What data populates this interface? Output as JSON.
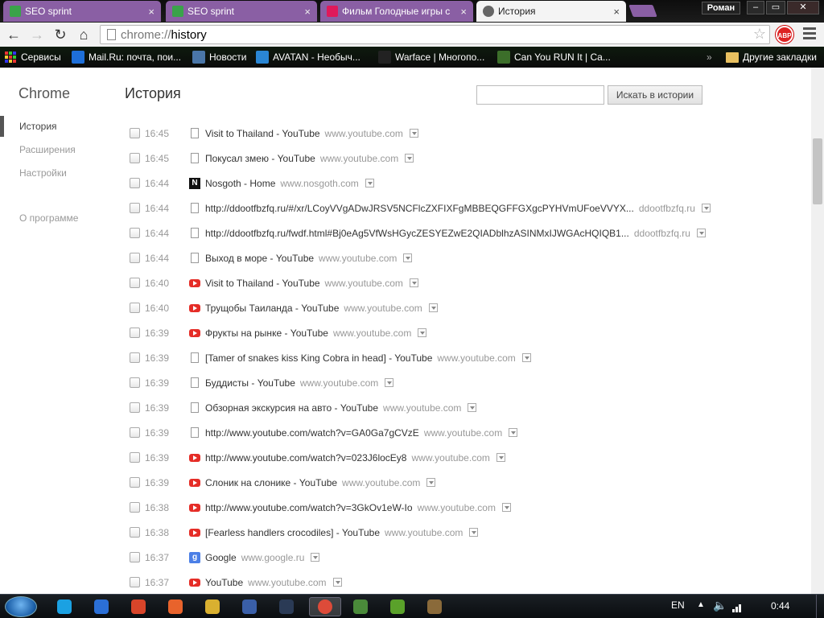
{
  "tabs": [
    {
      "label": "SEO sprint",
      "icon": "seo-sprint-icon",
      "color": "#3aa34a",
      "active": false
    },
    {
      "label": "SEO sprint",
      "icon": "seo-sprint-icon",
      "color": "#3aa34a",
      "active": false
    },
    {
      "label": "Фильм Голодные игры с",
      "icon": "ivi-icon",
      "color": "#e0195a",
      "active": false
    },
    {
      "label": "История",
      "icon": "history-icon",
      "color": "#666666",
      "active": true
    }
  ],
  "user": "Роман",
  "omnibox": {
    "scheme": "chrome://",
    "host": "history"
  },
  "abp_label": "ABP",
  "bookmarks": [
    {
      "label": "Сервисы",
      "icon": "apps-grid-icon"
    },
    {
      "label": "Mail.Ru: почта, пои...",
      "icon": "mailru-icon",
      "color": "#1e6fd9"
    },
    {
      "label": "Новости",
      "icon": "vk-icon",
      "color": "#4a76a8"
    },
    {
      "label": "AVATAN - Необыч...",
      "icon": "avatan-icon",
      "color": "#2a86d4"
    },
    {
      "label": "Warface | Многопо...",
      "icon": "warface-icon",
      "color": "#222222"
    },
    {
      "label": "Can You RUN It | Ca...",
      "icon": "canyourunit-icon",
      "color": "#3c6e2a"
    }
  ],
  "bookmarks_overflow": "»",
  "other_bookmarks": "Другие закладки",
  "sidebar": {
    "logo": "Chrome",
    "items": [
      {
        "label": "История",
        "active": true
      },
      {
        "label": "Расширения",
        "active": false
      },
      {
        "label": "Настройки",
        "active": false
      },
      {
        "label": "О программе",
        "active": false
      }
    ]
  },
  "page_title": "История",
  "search_button": "Искать в истории",
  "history": [
    {
      "time": "16:45",
      "title": "Visit to Thailand - YouTube",
      "domain": "www.youtube.com",
      "icon": "page"
    },
    {
      "time": "16:45",
      "title": "Покусал змею - YouTube",
      "domain": "www.youtube.com",
      "icon": "page"
    },
    {
      "time": "16:44",
      "title": "Nosgoth - Home",
      "domain": "www.nosgoth.com",
      "icon": "ns"
    },
    {
      "time": "16:44",
      "title": "http://ddootfbzfq.ru/#/xr/LCoyVVgADwJRSV5NCFlcZXFIXFgMBBEQGFFGXgcPYHVmUFoeVVYX...",
      "domain": "ddootfbzfq.ru",
      "icon": "page"
    },
    {
      "time": "16:44",
      "title": "http://ddootfbzfq.ru/fwdf.html#Bj0eAg5VfWsHGycZESYEZwE2QIADblhzASINMxIJWGAcHQIQB1...",
      "domain": "ddootfbzfq.ru",
      "icon": "page"
    },
    {
      "time": "16:44",
      "title": "Выход в море - YouTube",
      "domain": "www.youtube.com",
      "icon": "page"
    },
    {
      "time": "16:40",
      "title": "Visit to Thailand - YouTube",
      "domain": "www.youtube.com",
      "icon": "yt"
    },
    {
      "time": "16:40",
      "title": "Трущобы Таиланда - YouTube",
      "domain": "www.youtube.com",
      "icon": "yt"
    },
    {
      "time": "16:39",
      "title": "Фрукты на рынке - YouTube",
      "domain": "www.youtube.com",
      "icon": "yt"
    },
    {
      "time": "16:39",
      "title": "[Tamer of snakes kiss King Cobra in head] - YouTube",
      "domain": "www.youtube.com",
      "icon": "page"
    },
    {
      "time": "16:39",
      "title": "Буддисты - YouTube",
      "domain": "www.youtube.com",
      "icon": "page"
    },
    {
      "time": "16:39",
      "title": "Обзорная экскурсия на авто - YouTube",
      "domain": "www.youtube.com",
      "icon": "page"
    },
    {
      "time": "16:39",
      "title": "http://www.youtube.com/watch?v=GA0Ga7gCVzE",
      "domain": "www.youtube.com",
      "icon": "page"
    },
    {
      "time": "16:39",
      "title": "http://www.youtube.com/watch?v=023J6locEy8",
      "domain": "www.youtube.com",
      "icon": "yt"
    },
    {
      "time": "16:39",
      "title": "Слоник на слонике - YouTube",
      "domain": "www.youtube.com",
      "icon": "yt"
    },
    {
      "time": "16:38",
      "title": "http://www.youtube.com/watch?v=3GkOv1eW-Io",
      "domain": "www.youtube.com",
      "icon": "yt"
    },
    {
      "time": "16:38",
      "title": "[Fearless handlers crocodiles] - YouTube",
      "domain": "www.youtube.com",
      "icon": "yt"
    },
    {
      "time": "16:37",
      "title": "Google",
      "domain": "www.google.ru",
      "icon": "g"
    },
    {
      "time": "16:37",
      "title": "YouTube",
      "domain": "www.youtube.com",
      "icon": "yt"
    }
  ],
  "taskbar": {
    "apps": [
      {
        "name": "skype-icon",
        "color": "#1ba1e2"
      },
      {
        "name": "lightning-icon",
        "color": "#2b6fd6"
      },
      {
        "name": "red-swirl-icon",
        "color": "#d8452a"
      },
      {
        "name": "origin-icon",
        "color": "#e8632c"
      },
      {
        "name": "notes-icon",
        "color": "#d9b030"
      },
      {
        "name": "save-icon",
        "color": "#3a5fa8"
      },
      {
        "name": "steam-icon",
        "color": "#2a3a55"
      },
      {
        "name": "chrome-icon",
        "color": "#dd4b39",
        "active": true
      },
      {
        "name": "game-icon",
        "color": "#4a8a3a"
      },
      {
        "name": "utorrent-icon",
        "color": "#5aa12a"
      },
      {
        "name": "cube-icon",
        "color": "#8a6a3a"
      }
    ],
    "lang": "EN",
    "clock": "0:44"
  }
}
